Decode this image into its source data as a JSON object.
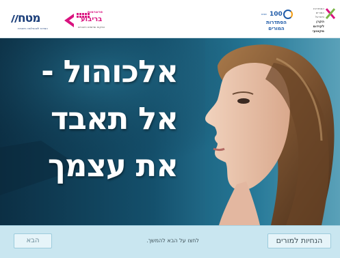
{
  "header": {
    "logo_left": {
      "name": "מטח",
      "subtitle": "המרכז לטכנולוגיה חינוכית"
    },
    "logo_bareva": {
      "line1": "פרוגרמות",
      "line2": "בריבוע",
      "line3": "הפקות ומיזמים חינוכיים"
    },
    "logo_histadrut": {
      "number": "100",
      "years": "שנים",
      "line1": "הסתדרות",
      "line2": "המורים"
    },
    "logo_fund": {
      "lines": [
        "הסתדרות",
        "המורים",
        "בישראל",
        "הקרן",
        "לקידום",
        "מקצועי"
      ]
    }
  },
  "hero": {
    "title_lines": [
      "אלכוהול -",
      "אל תאבד",
      "את עצמך"
    ]
  },
  "footer": {
    "next_label": "הבא",
    "hint_text": "לחצו על הבא להמשך.",
    "teacher_label": "הנחיות למורים"
  },
  "colors": {
    "navy": "#1c3f7a",
    "magenta": "#d9127f",
    "blue": "#1e5aa8",
    "footer_bg": "#c9e6f0"
  }
}
